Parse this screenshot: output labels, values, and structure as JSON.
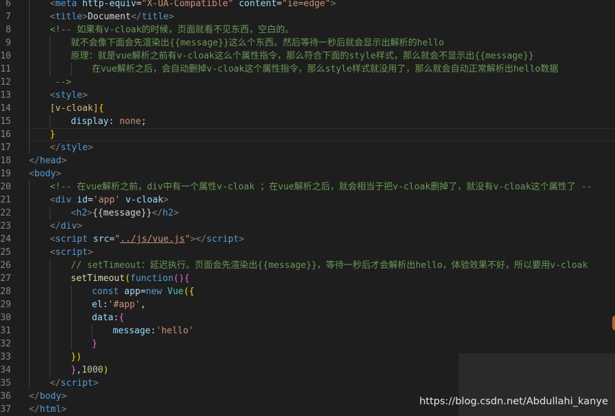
{
  "lines": [
    {
      "n": "6",
      "active": false,
      "tokens": [
        [
          "ind4",
          ""
        ],
        [
          "t-bracket",
          "<"
        ],
        [
          "t-tag",
          "meta "
        ],
        [
          "t-attr",
          "http-equiv"
        ],
        [
          "t-plain",
          "="
        ],
        [
          "t-str",
          "\"X-UA-Compatible\" "
        ],
        [
          "t-attr",
          "content"
        ],
        [
          "t-plain",
          "="
        ],
        [
          "t-str",
          "\"ie=edge\""
        ],
        [
          "t-bracket",
          ">"
        ]
      ]
    },
    {
      "n": "7",
      "active": false,
      "tokens": [
        [
          "ind4",
          ""
        ],
        [
          "t-bracket",
          "<"
        ],
        [
          "t-tag",
          "title"
        ],
        [
          "t-bracket",
          ">"
        ],
        [
          "t-text",
          "Document"
        ],
        [
          "t-bracket",
          "</"
        ],
        [
          "t-tag",
          "title"
        ],
        [
          "t-bracket",
          ">"
        ]
      ]
    },
    {
      "n": "8",
      "active": false,
      "tokens": [
        [
          "ind4",
          ""
        ],
        [
          "t-com",
          "<!-- 如果有v-cloak的时候，页面就看不见东西，空白的。"
        ]
      ]
    },
    {
      "n": "9",
      "active": false,
      "tokens": [
        [
          "ind8",
          ""
        ],
        [
          "t-com",
          "就不会像下面会先渲染出{{message}}这么个东西。然后等待一秒后就会显示出解析的hello"
        ]
      ]
    },
    {
      "n": "10",
      "active": false,
      "tokens": [
        [
          "ind8",
          ""
        ],
        [
          "t-com",
          "原理：就是vue解析之前有v-cloak这么个属性指令，那么符合下面的style样式，那么就会不显示出{{message}}"
        ]
      ]
    },
    {
      "n": "11",
      "active": false,
      "tokens": [
        [
          "ind12",
          ""
        ],
        [
          "t-com",
          "在vue解析之后，会自动删掉v-cloak这个属性指令，那么style样式就没用了，那么就会自动正常解析出hello数据"
        ]
      ]
    },
    {
      "n": "12",
      "active": false,
      "tokens": [
        [
          "ind5",
          ""
        ],
        [
          "t-com",
          "-->"
        ]
      ]
    },
    {
      "n": "13",
      "active": false,
      "tokens": [
        [
          "ind4",
          ""
        ],
        [
          "t-bracket",
          "<"
        ],
        [
          "t-tag",
          "style"
        ],
        [
          "t-bracket",
          ">"
        ]
      ]
    },
    {
      "n": "14",
      "active": false,
      "tokens": [
        [
          "ind4",
          ""
        ],
        [
          "t-sel",
          "[v-cloak]"
        ],
        [
          "t-brace",
          "{"
        ]
      ]
    },
    {
      "n": "15",
      "active": false,
      "tokens": [
        [
          "ind8",
          ""
        ],
        [
          "t-prop",
          "display"
        ],
        [
          "t-plain",
          ": "
        ],
        [
          "t-val",
          "none"
        ],
        [
          "t-plain",
          ";"
        ]
      ]
    },
    {
      "n": "16",
      "active": true,
      "tokens": [
        [
          "ind4",
          ""
        ],
        [
          "t-brace",
          "}"
        ]
      ]
    },
    {
      "n": "17",
      "active": false,
      "tokens": [
        [
          "ind4",
          ""
        ],
        [
          "t-bracket",
          "</"
        ],
        [
          "t-tag",
          "style"
        ],
        [
          "t-bracket",
          ">"
        ]
      ]
    },
    {
      "n": "18",
      "active": false,
      "tokens": [
        [
          "ind0",
          ""
        ],
        [
          "t-bracket",
          "</"
        ],
        [
          "t-tag",
          "head"
        ],
        [
          "t-bracket",
          ">"
        ]
      ]
    },
    {
      "n": "19",
      "active": false,
      "tokens": [
        [
          "ind0",
          ""
        ],
        [
          "t-bracket",
          "<"
        ],
        [
          "t-tag",
          "body"
        ],
        [
          "t-bracket",
          ">"
        ]
      ]
    },
    {
      "n": "20",
      "active": false,
      "tokens": [
        [
          "ind4",
          ""
        ],
        [
          "t-com",
          "<!-- 在vue解析之前，div中有一个属性v-cloak ；在vue解析之后，就会相当于把v-cloak删掉了，就没有v-cloak这个属性了 --"
        ]
      ]
    },
    {
      "n": "21",
      "active": false,
      "tokens": [
        [
          "ind4",
          ""
        ],
        [
          "t-bracket",
          "<"
        ],
        [
          "t-tag",
          "div "
        ],
        [
          "t-attr",
          "id"
        ],
        [
          "t-plain",
          "="
        ],
        [
          "t-str",
          "'app' "
        ],
        [
          "t-attr",
          "v-cloak"
        ],
        [
          "t-bracket",
          ">"
        ]
      ]
    },
    {
      "n": "22",
      "active": false,
      "tokens": [
        [
          "ind8",
          ""
        ],
        [
          "t-bracket",
          "<"
        ],
        [
          "t-tag",
          "h2"
        ],
        [
          "t-bracket",
          ">"
        ],
        [
          "t-text",
          "{{message}}"
        ],
        [
          "t-bracket",
          "</"
        ],
        [
          "t-tag",
          "h2"
        ],
        [
          "t-bracket",
          ">"
        ]
      ]
    },
    {
      "n": "23",
      "active": false,
      "tokens": [
        [
          "ind4",
          ""
        ],
        [
          "t-bracket",
          "</"
        ],
        [
          "t-tag",
          "div"
        ],
        [
          "t-bracket",
          ">"
        ]
      ]
    },
    {
      "n": "24",
      "active": false,
      "tokens": [
        [
          "ind4",
          ""
        ],
        [
          "t-bracket",
          "<"
        ],
        [
          "t-tag",
          "script "
        ],
        [
          "t-attr",
          "src"
        ],
        [
          "t-plain",
          "="
        ],
        [
          "t-str",
          "\""
        ],
        [
          "t-url",
          "../js/vue.js"
        ],
        [
          "t-str",
          "\""
        ],
        [
          "t-bracket",
          "></"
        ],
        [
          "t-tag",
          "script"
        ],
        [
          "t-bracket",
          ">"
        ]
      ]
    },
    {
      "n": "25",
      "active": false,
      "tokens": [
        [
          "ind4",
          ""
        ],
        [
          "t-bracket",
          "<"
        ],
        [
          "t-tag",
          "script"
        ],
        [
          "t-bracket",
          ">"
        ]
      ]
    },
    {
      "n": "26",
      "active": false,
      "tokens": [
        [
          "ind8",
          ""
        ],
        [
          "t-com",
          "// setTimeout：延迟执行。页面会先渲染出{{message}}，等待一秒后才会解析出hello，体验效果不好，所以要用v-cloak"
        ]
      ]
    },
    {
      "n": "27",
      "active": false,
      "tokens": [
        [
          "ind8",
          ""
        ],
        [
          "t-fn",
          "setTimeout"
        ],
        [
          "t-brace",
          "("
        ],
        [
          "t-kw",
          "function"
        ],
        [
          "t-brace2",
          "()"
        ],
        [
          "t-brace2",
          "{"
        ]
      ]
    },
    {
      "n": "28",
      "active": false,
      "tokens": [
        [
          "ind12",
          ""
        ],
        [
          "t-kw",
          "const "
        ],
        [
          "t-attr",
          "app"
        ],
        [
          "t-plain",
          "="
        ],
        [
          "t-kw",
          "new "
        ],
        [
          "t-cls",
          "Vue"
        ],
        [
          "t-brace",
          "({"
        ]
      ]
    },
    {
      "n": "29",
      "active": false,
      "tokens": [
        [
          "ind12",
          ""
        ],
        [
          "t-attr",
          "el"
        ],
        [
          "t-plain",
          ":"
        ],
        [
          "t-str",
          "'#app'"
        ],
        [
          "t-plain",
          ","
        ]
      ]
    },
    {
      "n": "30",
      "active": false,
      "tokens": [
        [
          "ind12",
          ""
        ],
        [
          "t-attr",
          "data"
        ],
        [
          "t-plain",
          ":"
        ],
        [
          "t-brace2",
          "{"
        ]
      ]
    },
    {
      "n": "31",
      "active": false,
      "tokens": [
        [
          "ind16",
          ""
        ],
        [
          "t-attr",
          "message"
        ],
        [
          "t-plain",
          ":"
        ],
        [
          "t-str",
          "'hello'"
        ]
      ]
    },
    {
      "n": "32",
      "active": false,
      "tokens": [
        [
          "ind12",
          ""
        ],
        [
          "t-brace2",
          "}"
        ]
      ]
    },
    {
      "n": "33",
      "active": false,
      "tokens": [
        [
          "ind8",
          ""
        ],
        [
          "t-brace",
          "})"
        ]
      ]
    },
    {
      "n": "34",
      "active": false,
      "tokens": [
        [
          "ind8",
          ""
        ],
        [
          "t-brace2",
          "}"
        ],
        [
          "t-plain",
          ","
        ],
        [
          "t-num",
          "1000"
        ],
        [
          "t-brace",
          ")"
        ]
      ]
    },
    {
      "n": "35",
      "active": false,
      "tokens": [
        [
          "ind4",
          ""
        ],
        [
          "t-bracket",
          "</"
        ],
        [
          "t-tag",
          "script"
        ],
        [
          "t-bracket",
          ">"
        ]
      ]
    },
    {
      "n": "36",
      "active": false,
      "tokens": [
        [
          "ind0",
          ""
        ],
        [
          "t-bracket",
          "</"
        ],
        [
          "t-tag",
          "body"
        ],
        [
          "t-bracket",
          ">"
        ]
      ]
    },
    {
      "n": "37",
      "active": false,
      "tokens": [
        [
          "ind0",
          ""
        ],
        [
          "t-bracket",
          "</"
        ],
        [
          "t-tag",
          "html"
        ],
        [
          "t-bracket",
          ">"
        ]
      ]
    }
  ],
  "watermark": "https://blog.csdn.net/Abdullahi_kanye"
}
